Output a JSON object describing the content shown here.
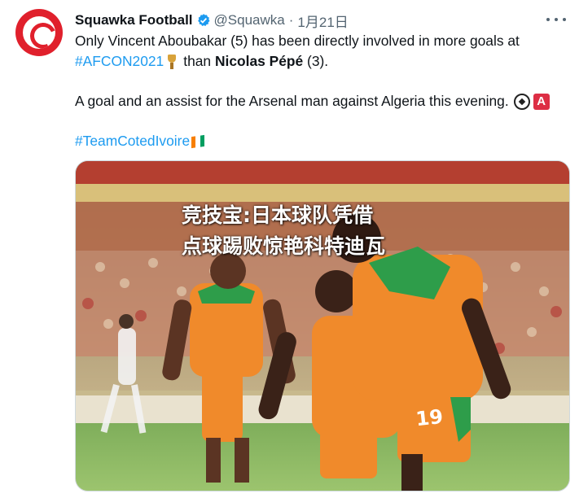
{
  "tweet": {
    "author_name": "Squawka Football",
    "handle": "@Squawka",
    "separator": "·",
    "date": "1月21日",
    "line1": "Only Vincent Aboubakar (5) has been directly involved in more goals at",
    "hashtag_afcon": "#AFCON2021",
    "than_text": "than",
    "player_name": "Nicolas Pépé",
    "count_text": "(3).",
    "line3": "A goal and an assist for the Arsenal man against Algeria this evening.",
    "a_badge": "A",
    "hashtag_team": "#TeamCotedIvoire"
  },
  "media": {
    "overlay_line1": "竞技宝:日本球队凭借",
    "overlay_line2": "点球踢败惊艳科特迪瓦",
    "shirt_number": "19"
  },
  "colors": {
    "link": "#1d9bf0",
    "verified": "#1d9bf0",
    "avatar": "#e0202c",
    "jersey": "#f08a2b",
    "jersey_trim": "#2e9d4a"
  },
  "icons": [
    "avatar-logo",
    "verified-badge-icon",
    "more-options-icon",
    "trophy-emoji",
    "soccer-ball-emoji",
    "a-button-emoji",
    "ivory-coast-flag-emoji"
  ]
}
